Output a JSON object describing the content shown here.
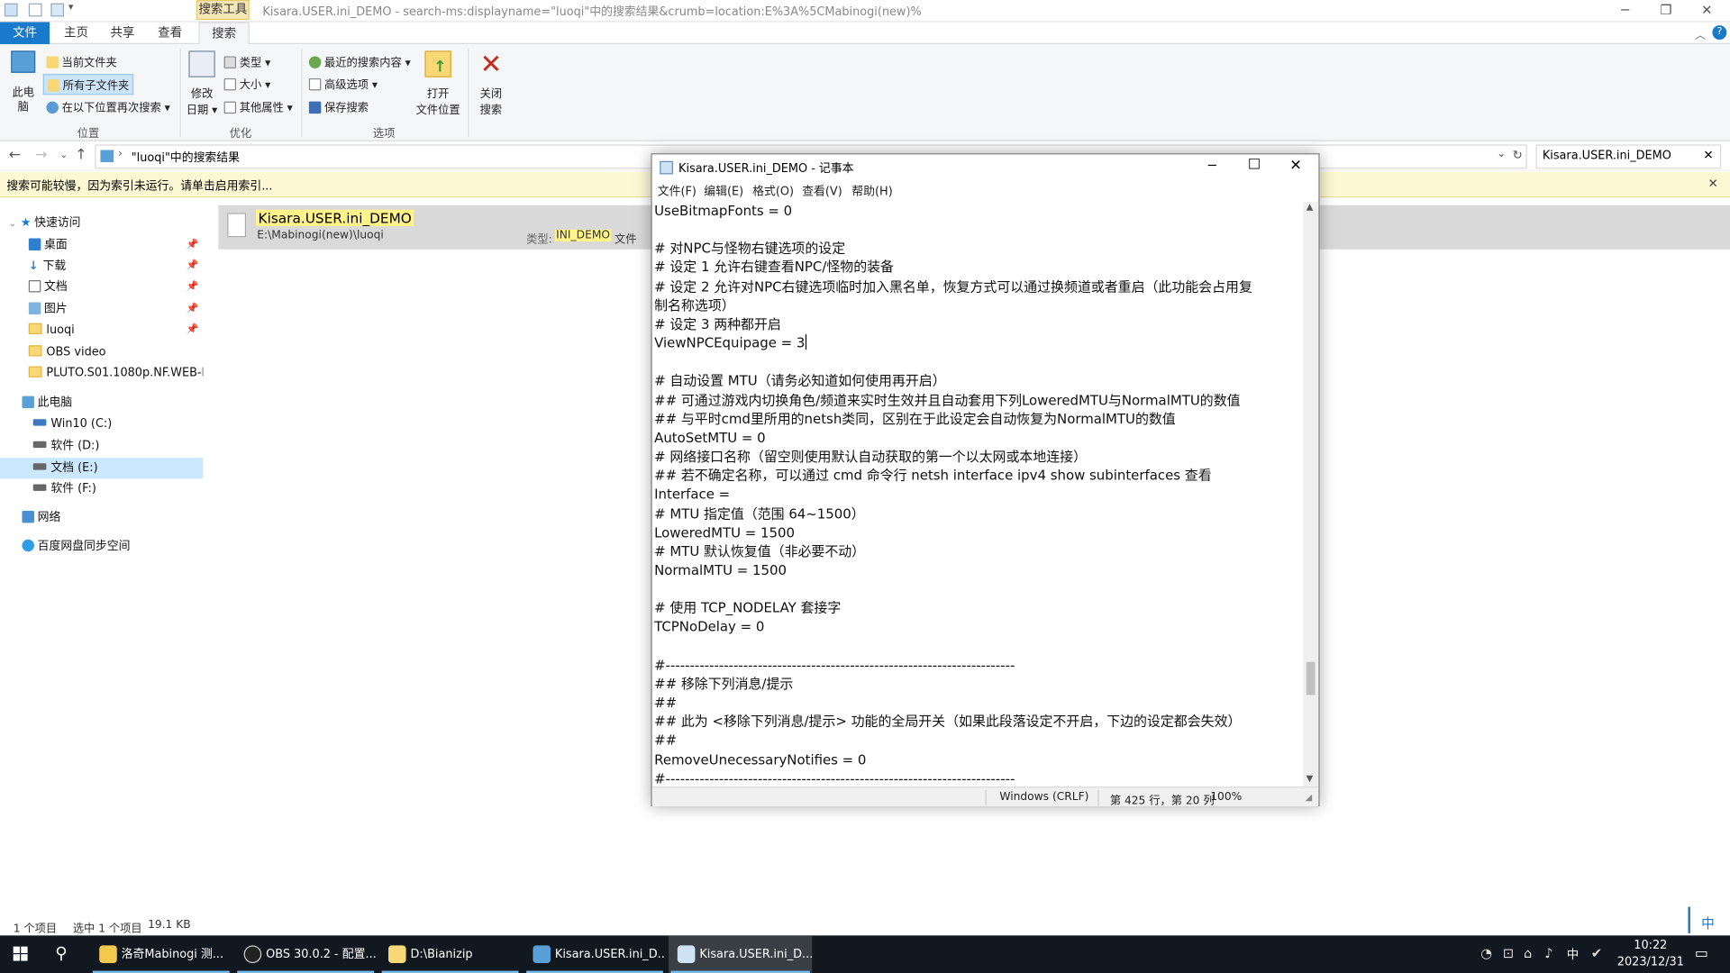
{
  "explorer": {
    "window_title": "Kisara.USER.ini_DEMO - search-ms:displayname=\"luoqi\"中的搜索结果&crumb=location:E%3A%5CMabinogi(new)%",
    "context_tab": "搜索工具",
    "ribbon_tabs": [
      {
        "label": "文件"
      },
      {
        "label": "主页"
      },
      {
        "label": "共享"
      },
      {
        "label": "查看"
      },
      {
        "label": "搜索"
      }
    ],
    "ribbon": {
      "this_pc": "此电\n脑",
      "this_pc_l1": "此电",
      "this_pc_l2": "脑",
      "current_folder": "当前文件夹",
      "all_subfolders": "所有子文件夹",
      "search_again": "在以下位置再次搜索",
      "group_location": "位置",
      "modified_l1": "修改",
      "modified_l2": "日期",
      "type": "类型",
      "size": "大小",
      "other_props": "其他属性",
      "group_refine": "优化",
      "recent_searches": "最近的搜索内容",
      "advanced": "高级选项",
      "save_search": "保存搜索",
      "group_options": "选项",
      "open_loc_l1": "打开",
      "open_loc_l2": "文件位置",
      "close_l1": "关闭",
      "close_l2": "搜索"
    },
    "address": "\"luoqi\"中的搜索结果",
    "search_value": "Kisara.USER.ini_DEMO",
    "info_bar": "搜索可能较慢，因为索引未运行。请单击启用索引...",
    "nav": {
      "quick_access": "快速访问",
      "quick_items": [
        {
          "label": "桌面",
          "pinned": true
        },
        {
          "label": "下载",
          "pinned": true
        },
        {
          "label": "文档",
          "pinned": true
        },
        {
          "label": "图片",
          "pinned": true
        },
        {
          "label": "luoqi",
          "pinned": true
        },
        {
          "label": "OBS video",
          "pinned": false
        },
        {
          "label": "PLUTO.S01.1080p.NF.WEB-DL",
          "pinned": false
        }
      ],
      "this_pc": "此电脑",
      "drives": [
        {
          "label": "Win10 (C:)"
        },
        {
          "label": "软件 (D:)"
        },
        {
          "label": "文档 (E:)"
        },
        {
          "label": "软件 (F:)"
        }
      ],
      "network": "网络",
      "baidu": "百度网盘同步空间"
    },
    "result": {
      "name": "Kisara.USER.ini_DEMO",
      "path": "E:\\Mabinogi(new)\\luoqi",
      "type_label": "类型:",
      "type_value": "INI_DEMO",
      "type_suffix": "文件"
    },
    "status": {
      "count": "1 个项目",
      "selected": "选中 1 个项目",
      "size": "19.1 KB"
    }
  },
  "notepad": {
    "title": "Kisara.USER.ini_DEMO - 记事本",
    "menu": [
      "文件(F)",
      "编辑(E)",
      "格式(O)",
      "查看(V)",
      "帮助(H)"
    ],
    "lines": [
      "UseBitmapFonts = 0",
      "",
      "# 对NPC与怪物右键选项的设定",
      "# 设定 1 允许右键查看NPC/怪物的装备",
      "# 设定 2 允许对NPC右键选项临时加入黑名单，恢复方式可以通过换频道或者重启（此功能会占用复",
      "制名称选项）",
      "# 设定 3 两种都开启",
      "ViewNPCEquipage = 3",
      "",
      "# 自动设置 MTU（请务必知道如何使用再开启）",
      "## 可通过游戏内切换角色/频道来实时生效并且自动套用下列LoweredMTU与NormalMTU的数值",
      "## 与平时cmd里所用的netsh类同，区别在于此设定会自动恢复为NormalMTU的数值",
      "AutoSetMTU = 0",
      "# 网络接口名称（留空则使用默认自动获取的第一个以太网或本地连接）",
      "## 若不确定名称，可以通过 cmd 命令行 netsh interface ipv4 show subinterfaces 查看",
      "Interface =",
      "# MTU 指定值（范围 64~1500）",
      "LoweredMTU = 1500",
      "# MTU 默认恢复值（非必要不动）",
      "NormalMTU = 1500",
      "",
      "# 使用 TCP_NODELAY 套接字",
      "TCPNoDelay = 0",
      "",
      "#------------------------------------------------------------------------",
      "## 移除下列消息/提示",
      "##",
      "## 此为 <移除下列消息/提示> 功能的全局开关（如果此段落设定不开启，下边的设定都会失效）",
      "##",
      "RemoveUnecessaryNotifies = 0",
      "#------------------------------------------------------------------------"
    ],
    "status_encoding": "Windows (CRLF)",
    "status_position": "第 425 行，第 20 列",
    "status_zoom": "100%"
  },
  "taskbar": {
    "items": [
      {
        "label": "洛奇Mabinogi 测..."
      },
      {
        "label": "OBS 30.0.2 - 配置..."
      },
      {
        "label": "D:\\Bianizip"
      },
      {
        "label": "Kisara.USER.ini_D..."
      },
      {
        "label": "Kisara.USER.ini_D..."
      }
    ],
    "ime": "中",
    "time": "10:22",
    "date": "2023/12/31",
    "ime_tray": "中"
  }
}
